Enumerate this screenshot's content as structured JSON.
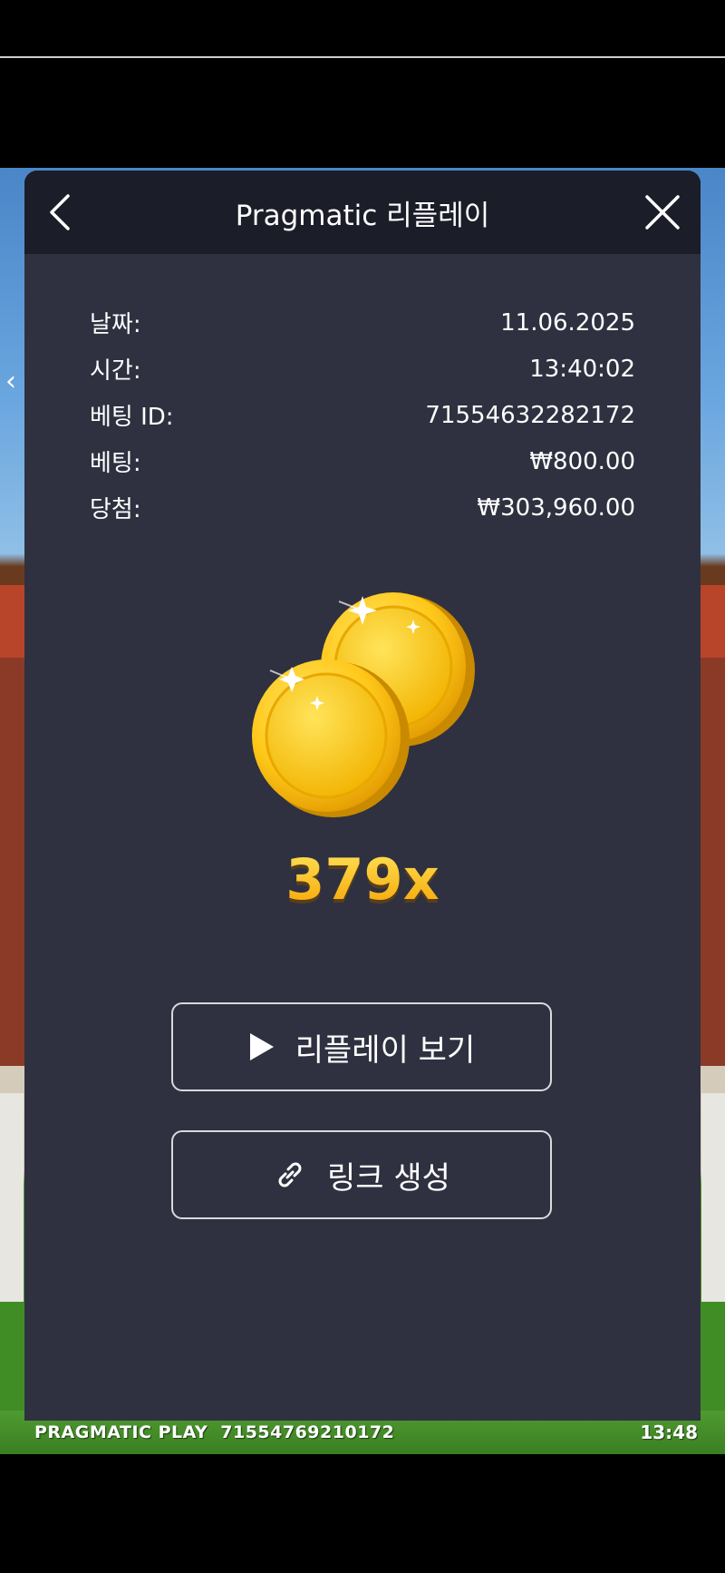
{
  "dialog": {
    "title": "Pragmatic 리플레이",
    "back_icon": "chevron-left-icon",
    "close_icon": "close-icon"
  },
  "info": [
    {
      "label": "날짜:",
      "value": "11.06.2025"
    },
    {
      "label": "시간:",
      "value": "13:40:02"
    },
    {
      "label": "베팅 ID:",
      "value": "71554632282172"
    },
    {
      "label": "베팅:",
      "value": "₩800.00"
    },
    {
      "label": "당첨:",
      "value": "₩303,960.00"
    }
  ],
  "multiplier": "379x",
  "buttons": {
    "replay": {
      "label": "리플레이 보기",
      "icon": "play-icon"
    },
    "link": {
      "label": "링크 생성",
      "icon": "link-icon"
    }
  },
  "footer": {
    "brand": "PRAGMATIC PLAY",
    "bet_id": "71554769210172",
    "time": "13:48"
  },
  "colors": {
    "dialog_bg": "#2f3140",
    "header_bg": "#1b1d29",
    "multiplier": "#ffc21a"
  }
}
